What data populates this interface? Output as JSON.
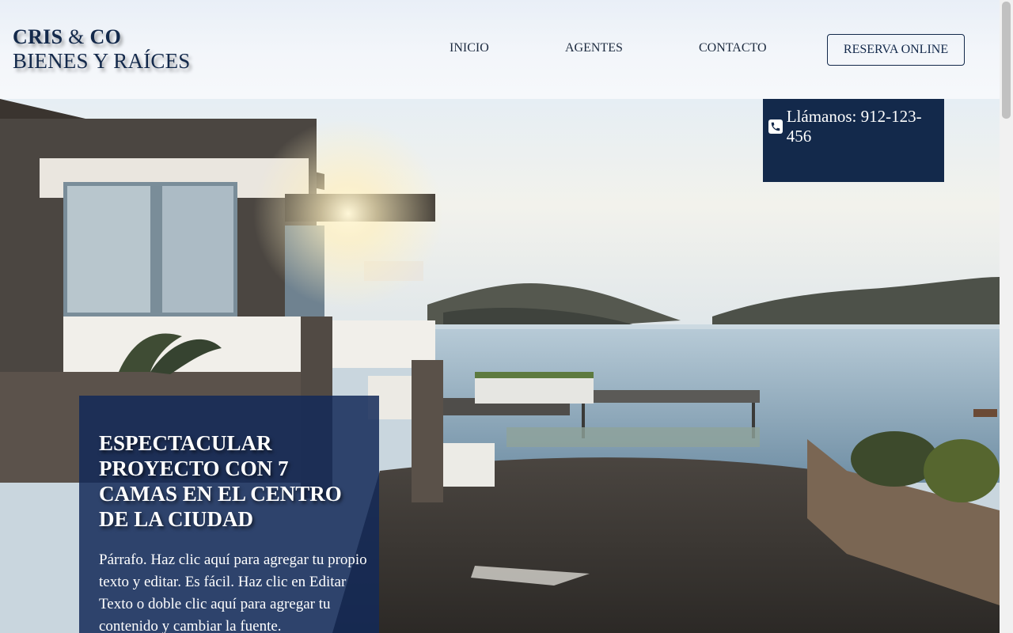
{
  "brand": {
    "line1_a": "CRIS",
    "line1_amp": "&",
    "line1_b": "CO",
    "line2": "BIENES Y RAÍCES"
  },
  "nav": {
    "items": [
      {
        "label": "INICIO"
      },
      {
        "label": "AGENTES"
      },
      {
        "label": "CONTACTO"
      }
    ],
    "reserve_label": "RESERVA ONLINE"
  },
  "phone": {
    "icon": "phone-icon",
    "text": "Llámanos: 912-123-456"
  },
  "promo": {
    "title": "ESPECTACULAR PROYECTO CON 7 CAMAS EN EL CENTRO DE LA CIUDAD",
    "body": "Párrafo. Haz clic aquí para agregar tu propio texto y editar. Es fácil. Haz clic en Editar Texto o doble clic aquí para agregar tu contenido y cambiar la fuente."
  },
  "colors": {
    "brand_navy": "#13294b",
    "promo_bg": "#132958"
  }
}
